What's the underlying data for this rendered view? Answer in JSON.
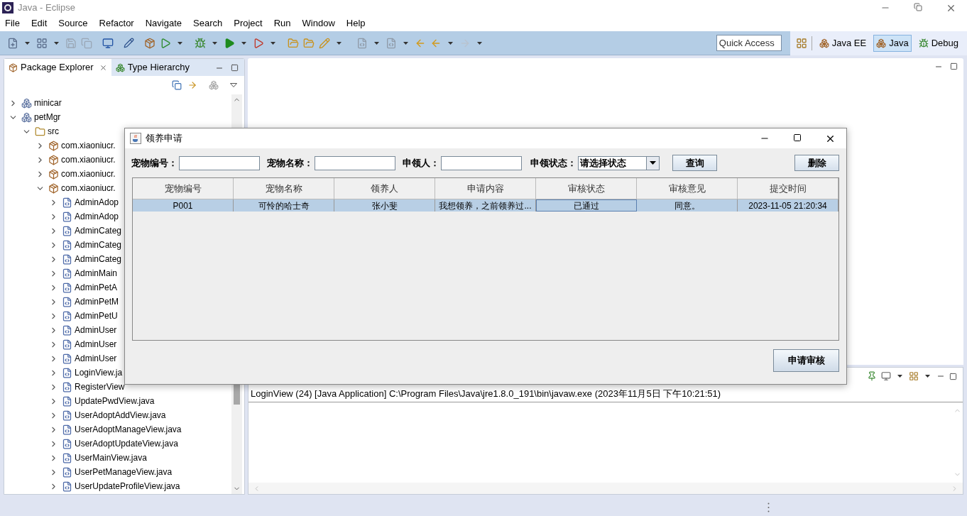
{
  "window": {
    "title": "Java - Eclipse"
  },
  "menu": [
    "File",
    "Edit",
    "Source",
    "Refactor",
    "Navigate",
    "Search",
    "Project",
    "Run",
    "Window",
    "Help"
  ],
  "quick_access": {
    "placeholder": "Quick Access"
  },
  "perspectives": [
    {
      "label": "Java EE",
      "selected": false
    },
    {
      "label": "Java",
      "selected": true
    },
    {
      "label": "Debug",
      "selected": false
    }
  ],
  "left_tabs": [
    {
      "label": "Package Explorer",
      "selected": true
    },
    {
      "label": "Type Hierarchy",
      "selected": false
    }
  ],
  "tree": [
    {
      "label": "minicar",
      "kind": "project",
      "expanded": false
    },
    {
      "label": "petMgr",
      "kind": "project",
      "expanded": true,
      "children": [
        {
          "label": "src",
          "kind": "folder",
          "expanded": true,
          "children": [
            {
              "label": "com.xiaoniucr.",
              "kind": "package",
              "expanded": false
            },
            {
              "label": "com.xiaoniucr.",
              "kind": "package",
              "expanded": false
            },
            {
              "label": "com.xiaoniucr.",
              "kind": "package",
              "expanded": false
            },
            {
              "label": "com.xiaoniucr.",
              "kind": "package",
              "expanded": true,
              "children": [
                {
                  "label": "AdminAdop",
                  "kind": "file",
                  "expanded": false
                },
                {
                  "label": "AdminAdop",
                  "kind": "file",
                  "expanded": false
                },
                {
                  "label": "AdminCateg",
                  "kind": "file",
                  "expanded": false
                },
                {
                  "label": "AdminCateg",
                  "kind": "file",
                  "expanded": false
                },
                {
                  "label": "AdminCateg",
                  "kind": "file",
                  "expanded": false
                },
                {
                  "label": "AdminMain",
                  "kind": "file",
                  "expanded": false
                },
                {
                  "label": "AdminPetA",
                  "kind": "file",
                  "expanded": false
                },
                {
                  "label": "AdminPetM",
                  "kind": "file",
                  "expanded": false
                },
                {
                  "label": "AdminPetU",
                  "kind": "file",
                  "expanded": false
                },
                {
                  "label": "AdminUser",
                  "kind": "file",
                  "expanded": false
                },
                {
                  "label": "AdminUser",
                  "kind": "file",
                  "expanded": false
                },
                {
                  "label": "AdminUser",
                  "kind": "file",
                  "expanded": false
                },
                {
                  "label": "LoginView.ja",
                  "kind": "file",
                  "expanded": false
                },
                {
                  "label": "RegisterView",
                  "kind": "file",
                  "expanded": false
                },
                {
                  "label": "UpdatePwdView.java",
                  "kind": "file",
                  "expanded": false
                },
                {
                  "label": "UserAdoptAddView.java",
                  "kind": "file",
                  "expanded": false
                },
                {
                  "label": "UserAdoptManageView.java",
                  "kind": "file",
                  "expanded": false
                },
                {
                  "label": "UserAdoptUpdateView.java",
                  "kind": "file",
                  "expanded": false
                },
                {
                  "label": "UserMainView.java",
                  "kind": "file",
                  "expanded": false
                },
                {
                  "label": "UserPetManageView.java",
                  "kind": "file",
                  "expanded": false
                },
                {
                  "label": "UserUpdateProfileView.java",
                  "kind": "file",
                  "expanded": false
                }
              ]
            }
          ]
        }
      ]
    }
  ],
  "console": {
    "header": "LoginView (24) [Java Application] C:\\Program Files\\Java\\jre1.8.0_191\\bin\\javaw.exe (2023年11月5日 下午10:21:51)"
  },
  "dialog": {
    "title": "领养申请",
    "filters": [
      {
        "label": "宠物编号：",
        "kind": "text"
      },
      {
        "label": "宠物名称：",
        "kind": "text"
      },
      {
        "label": "申领人：",
        "kind": "text"
      },
      {
        "label": "申领状态：",
        "kind": "select",
        "value": "请选择状态"
      }
    ],
    "query_button": "查询",
    "delete_button": "删除",
    "review_button": "申请审核",
    "table": {
      "columns": [
        "宠物编号",
        "宠物名称",
        "领养人",
        "申请内容",
        "审核状态",
        "审核意见",
        "提交时间"
      ],
      "rows": [
        {
          "selected": true,
          "cells": [
            "P001",
            "可怜的哈士奇",
            "张小斐",
            "我想领养，之前领养过...",
            "已通过",
            "同意。",
            "2023-11-05 21:20:34"
          ]
        }
      ]
    }
  }
}
